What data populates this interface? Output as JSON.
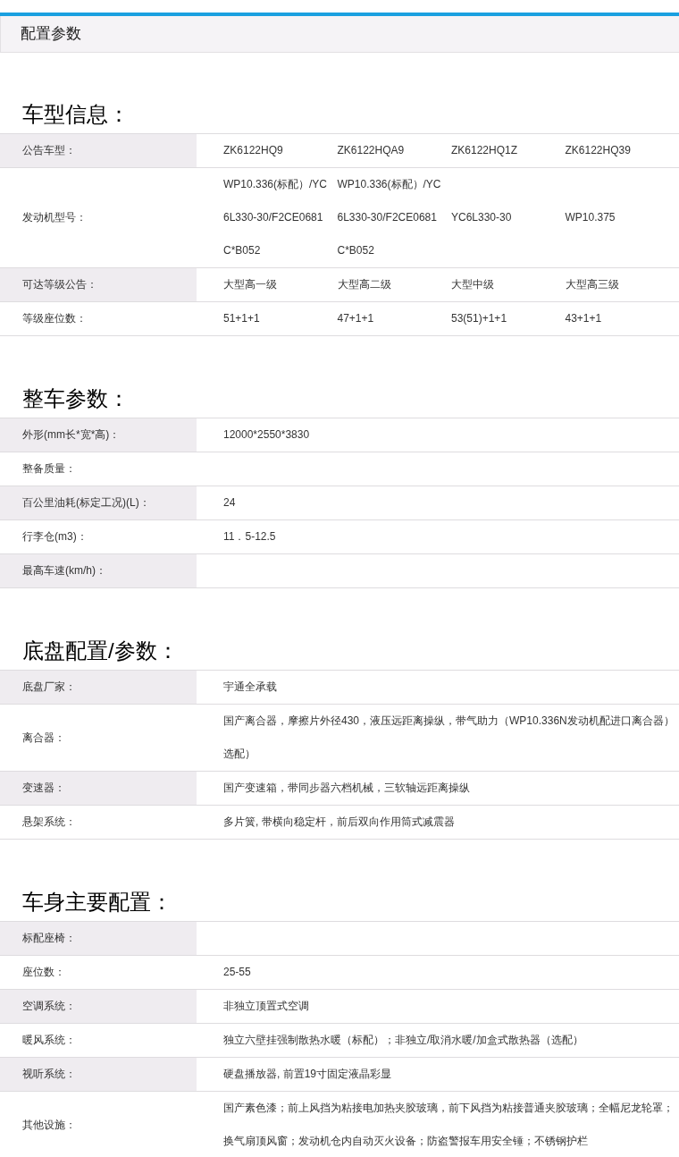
{
  "page_title": "配置参数",
  "sections": [
    {
      "title": "车型信息：",
      "rows": [
        {
          "label": "公告车型：",
          "values": [
            "ZK6122HQ9",
            "ZK6122HQA9",
            "ZK6122HQ1Z",
            "ZK6122HQ39"
          ]
        },
        {
          "label": "发动机型号：",
          "values": [
            "WP10.336(标配）/YC6L330-30/F2CE0681C*B052",
            "WP10.336(标配）/YC6L330-30/F2CE0681C*B052",
            "YC6L330-30",
            "WP10.375"
          ]
        },
        {
          "label": "可达等级公告：",
          "values": [
            "大型高一级",
            "大型高二级",
            "大型中级",
            "大型高三级"
          ]
        },
        {
          "label": "等级座位数：",
          "values": [
            "51+1+1",
            "47+1+1",
            "53(51)+1+1",
            "43+1+1"
          ]
        }
      ]
    },
    {
      "title": "整车参数：",
      "rows": [
        {
          "label": "外形(mm长*宽*高)：",
          "values": [
            "12000*2550*3830"
          ]
        },
        {
          "label": "整备质量："
        },
        {
          "label": "百公里油耗(标定工况)(L)：",
          "values": [
            "24"
          ]
        },
        {
          "label": "行李仓(m3)：",
          "values": [
            "11．5-12.5"
          ]
        },
        {
          "label": "最高车速(km/h)："
        }
      ]
    },
    {
      "title": "底盘配置/参数：",
      "rows": [
        {
          "label": "底盘厂家：",
          "values": [
            "宇通全承载"
          ]
        },
        {
          "label": "离合器：",
          "values": [
            "国产离合器，摩擦片外径430，液压远距离操纵，带气助力（WP10.336N发动机配进口离合器）选配）"
          ]
        },
        {
          "label": "变速器：",
          "values": [
            "国产变速箱，带同步器六档机械，三软轴远距离操纵"
          ]
        },
        {
          "label": "悬架系统：",
          "values": [
            "多片簧, 带横向稳定杆，前后双向作用筒式减震器"
          ]
        }
      ]
    },
    {
      "title": "车身主要配置：",
      "rows": [
        {
          "label": "标配座椅："
        },
        {
          "label": "座位数：",
          "values": [
            "25-55"
          ]
        },
        {
          "label": "空调系统：",
          "values": [
            "非独立顶置式空调"
          ]
        },
        {
          "label": "暖风系统：",
          "values": [
            "独立六壁挂强制散热水暖（标配）；非独立/取消水暖/加盒式散热器（选配）"
          ]
        },
        {
          "label": "视听系统：",
          "values": [
            "硬盘播放器, 前置19寸固定液晶彩显"
          ]
        },
        {
          "label": "其他设施：",
          "values": [
            "国产素色漆；前上风挡为粘接电加热夹胶玻璃，前下风挡为粘接普通夹胶玻璃；全幅尼龙轮罩；换气扇顶风窗；发动机仓内自动灭火设备；防盗警报车用安全锤；不锈钢护栏"
          ]
        }
      ]
    }
  ]
}
